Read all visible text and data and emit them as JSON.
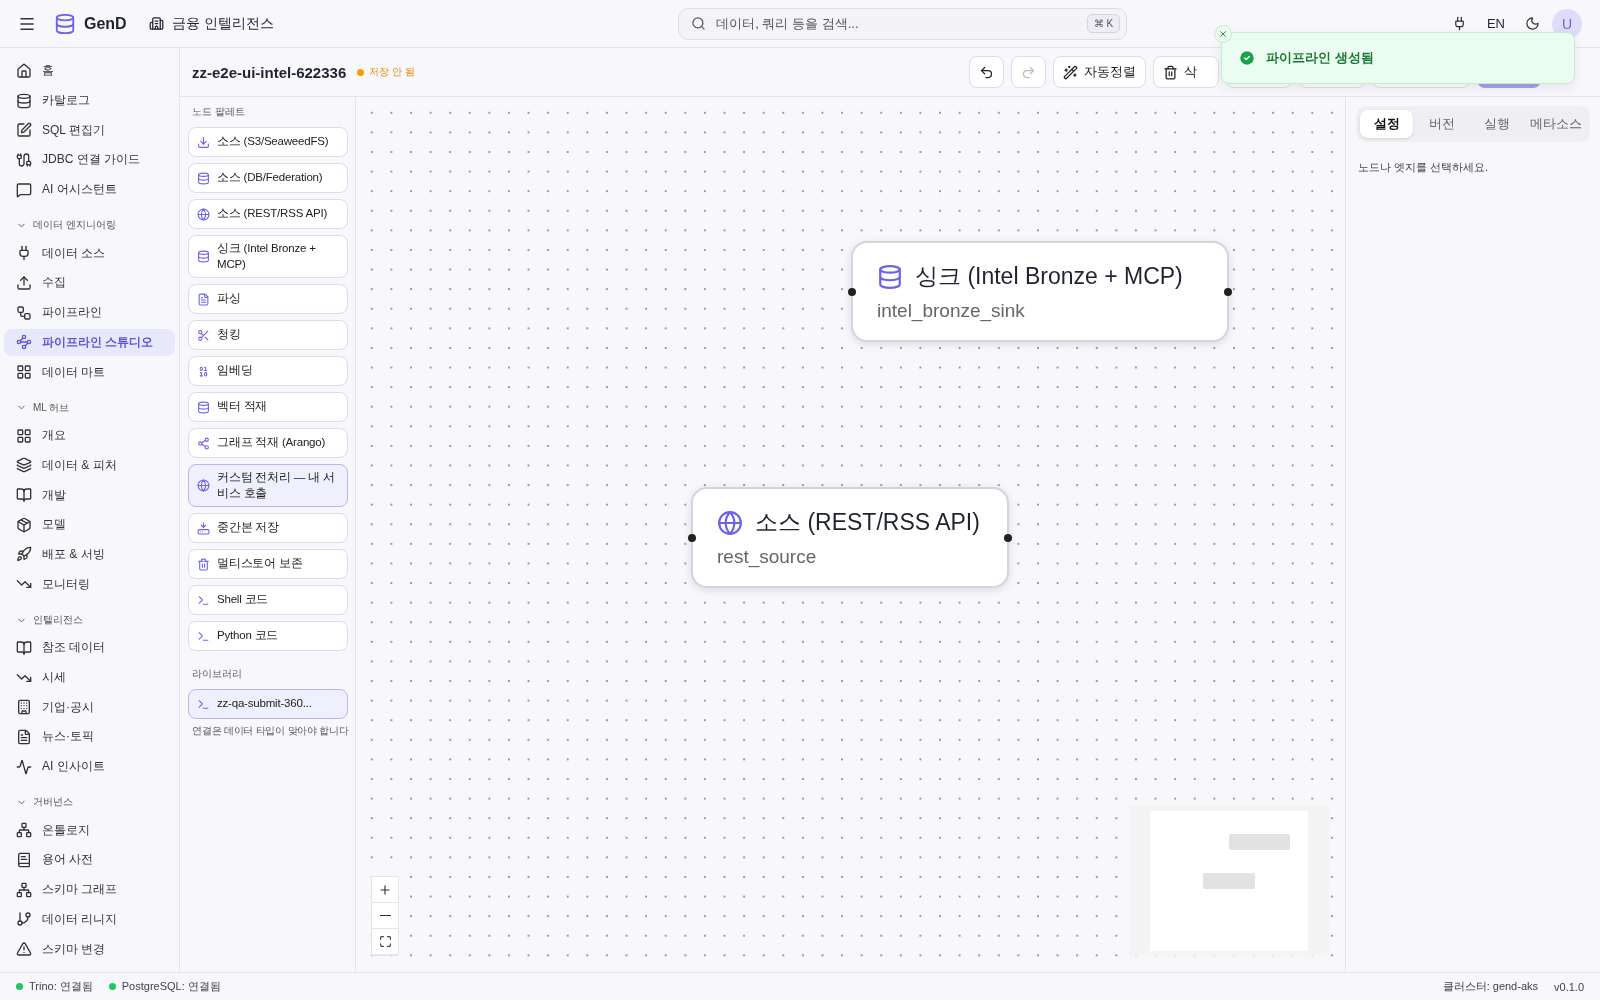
{
  "header": {
    "brand": "GenD",
    "workspace": "금융 인텔리전스",
    "search": {
      "placeholder": "데이터, 쿼리 등을 검색...",
      "shortcut": "⌘ K"
    },
    "language": "EN",
    "avatar": "U"
  },
  "sidebar": {
    "groups": [
      {
        "items": [
          {
            "label": "홈",
            "selected": false
          },
          {
            "label": "카탈로그",
            "selected": false
          },
          {
            "label": "SQL 편집기",
            "selected": false
          },
          {
            "label": "JDBC 연결 가이드",
            "selected": false
          },
          {
            "label": "AI 어시스턴트",
            "selected": false
          }
        ]
      },
      {
        "title": "데이터 엔지니어링",
        "expanded": true,
        "items": [
          {
            "label": "데이터 소스",
            "selected": false
          },
          {
            "label": "수집",
            "selected": false
          },
          {
            "label": "파이프라인",
            "selected": false
          },
          {
            "label": "파이프라인 스튜디오",
            "selected": true
          },
          {
            "label": "데이터 마트",
            "selected": false
          }
        ]
      },
      {
        "title": "ML 허브",
        "expanded": true,
        "items": [
          {
            "label": "개요",
            "selected": false
          },
          {
            "label": "데이터 & 피처",
            "selected": false
          },
          {
            "label": "개발",
            "selected": false
          },
          {
            "label": "모델",
            "selected": false
          },
          {
            "label": "배포 & 서빙",
            "selected": false
          },
          {
            "label": "모니터링",
            "selected": false
          }
        ]
      },
      {
        "title": "인텔리전스",
        "expanded": true,
        "items": [
          {
            "label": "참조 데이터",
            "selected": false
          },
          {
            "label": "시세",
            "selected": false
          },
          {
            "label": "기업·공시",
            "selected": false
          },
          {
            "label": "뉴스·토픽",
            "selected": false
          },
          {
            "label": "AI 인사이트",
            "selected": false
          }
        ]
      },
      {
        "title": "거버넌스",
        "expanded": true,
        "items": [
          {
            "label": "온톨로지",
            "selected": false
          },
          {
            "label": "용어 사전",
            "selected": false
          },
          {
            "label": "스키마 그래프",
            "selected": false
          },
          {
            "label": "데이터 리니지",
            "selected": false
          },
          {
            "label": "스키마 변경",
            "selected": false
          }
        ]
      }
    ]
  },
  "toolbar": {
    "title": "zz-e2e-ui-intel-622336",
    "status": "저장 안 됨",
    "buttons": [
      {
        "kind": "undo",
        "disabled": false
      },
      {
        "kind": "redo",
        "disabled": true
      },
      {
        "kind": "autolayout",
        "label": "자동정렬",
        "disabled": false
      },
      {
        "kind": "delete",
        "label": "삭",
        "disabled": false
      }
    ]
  },
  "palette": {
    "title": "노드 팔레트",
    "items": [
      {
        "label": "소스 (S3/SeaweedFS)",
        "selected": false
      },
      {
        "label": "소스 (DB/Federation)",
        "selected": false
      },
      {
        "label": "소스 (REST/RSS API)",
        "selected": false
      },
      {
        "label": "싱크 (Intel Bronze + MCP)",
        "selected": false
      },
      {
        "label": "파싱",
        "selected": false
      },
      {
        "label": "청킹",
        "selected": false
      },
      {
        "label": "임베딩",
        "selected": false
      },
      {
        "label": "벡터 적재",
        "selected": false
      },
      {
        "label": "그래프 적재 (Arango)",
        "selected": false
      },
      {
        "label": "커스텀 전처리 — 내 서비스 호출",
        "selected": true
      },
      {
        "label": "중간본 저장",
        "selected": false
      },
      {
        "label": "멀티스토어 보존",
        "selected": false
      },
      {
        "label": "Shell 코드",
        "selected": false
      },
      {
        "label": "Python 코드",
        "selected": false
      }
    ],
    "library_title": "라이브러리",
    "library": [
      {
        "label": "zz-qa-submit-360...",
        "selected": true
      }
    ],
    "hint": "연결은 데이터 타입이 맞아야 합니다"
  },
  "canvas": {
    "nodes": [
      {
        "kind": "sink",
        "title": "싱크 (Intel Bronze + MCP)",
        "name": "intel_bronze_sink"
      },
      {
        "kind": "source",
        "title": "소스 (REST/RSS API)",
        "name": "rest_source"
      }
    ]
  },
  "inspector": {
    "tabs": [
      {
        "label": "설정",
        "selected": true
      },
      {
        "label": "버전",
        "selected": false
      },
      {
        "label": "실행",
        "selected": false
      },
      {
        "label": "메타소스",
        "selected": false
      }
    ],
    "empty_message": "노드나 엣지를 선택하세요."
  },
  "toast": {
    "message": "파이프라인 생성됨"
  },
  "status_bar": {
    "connections": [
      {
        "label": "Trino: 연결됨",
        "color": "#22c55e"
      },
      {
        "label": "PostgreSQL: 연결됨",
        "color": "#22c55e"
      }
    ],
    "cluster": "클러스터: gend-aks",
    "version": "v0.1.0"
  }
}
